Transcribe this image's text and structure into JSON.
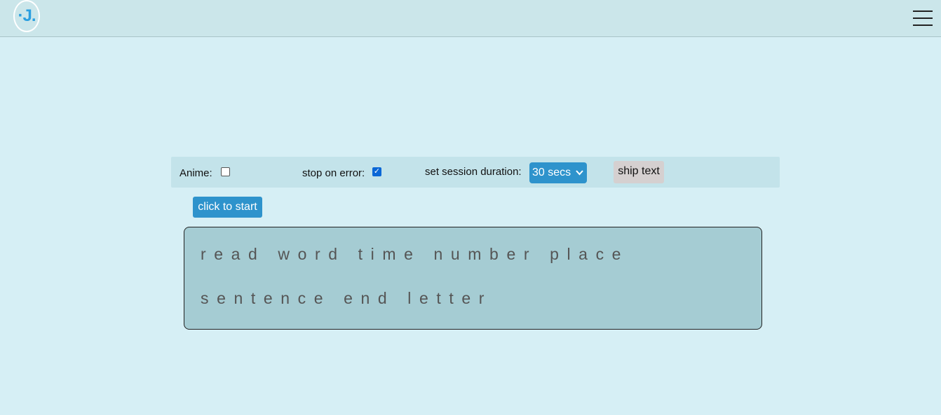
{
  "header": {
    "logo_text": "·J.",
    "menu_icon": "hamburger-menu-icon"
  },
  "toolbar": {
    "anime_label": "Anime:",
    "anime_checked": false,
    "stop_on_error_label": "stop on error:",
    "stop_on_error_checked": true,
    "duration_label": "set session duration:",
    "duration_value": "30 secs",
    "ship_text_label": "ship text"
  },
  "start_button_label": "click to start",
  "practice_text": {
    "line1": "read word time number place",
    "line2": "sentence end letter"
  },
  "colors": {
    "background": "#d6eff5",
    "header": "#cbe6ea",
    "accent": "#2e93cc",
    "text_box": "#a5ccd3",
    "ship_button": "#d5d0d0"
  }
}
